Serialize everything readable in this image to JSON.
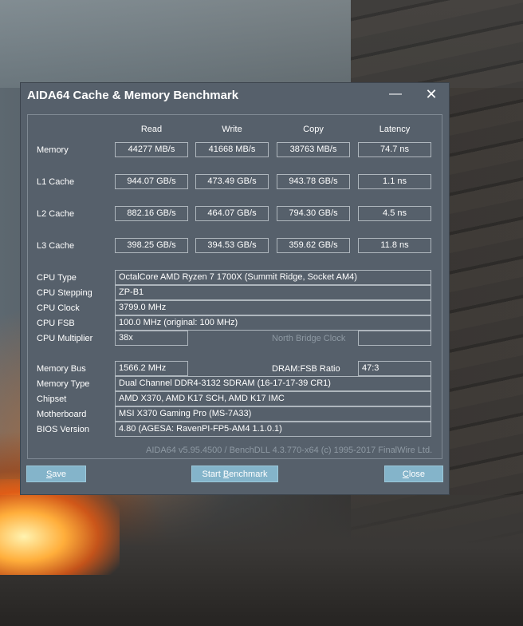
{
  "window": {
    "title": "AIDA64 Cache & Memory Benchmark",
    "minimize_glyph": "—",
    "close_glyph": "✕"
  },
  "headers": {
    "read": "Read",
    "write": "Write",
    "copy": "Copy",
    "latency": "Latency"
  },
  "rows": [
    {
      "label": "Memory",
      "read": "44277 MB/s",
      "write": "41668 MB/s",
      "copy": "38763 MB/s",
      "latency": "74.7 ns"
    },
    {
      "label": "L1 Cache",
      "read": "944.07 GB/s",
      "write": "473.49 GB/s",
      "copy": "943.78 GB/s",
      "latency": "1.1 ns"
    },
    {
      "label": "L2 Cache",
      "read": "882.16 GB/s",
      "write": "464.07 GB/s",
      "copy": "794.30 GB/s",
      "latency": "4.5 ns"
    },
    {
      "label": "L3 Cache",
      "read": "398.25 GB/s",
      "write": "394.53 GB/s",
      "copy": "359.62 GB/s",
      "latency": "11.8 ns"
    }
  ],
  "cpu": {
    "type_label": "CPU Type",
    "type": "OctalCore AMD Ryzen 7 1700X  (Summit Ridge, Socket AM4)",
    "stepping_label": "CPU Stepping",
    "stepping": "ZP-B1",
    "clock_label": "CPU Clock",
    "clock": "3799.0 MHz",
    "fsb_label": "CPU FSB",
    "fsb": "100.0 MHz  (original: 100 MHz)",
    "multiplier_label": "CPU Multiplier",
    "multiplier": "38x",
    "nb_clock_label": "North Bridge Clock",
    "nb_clock": ""
  },
  "memory": {
    "bus_label": "Memory Bus",
    "bus": "1566.2 MHz",
    "ratio_label": "DRAM:FSB Ratio",
    "ratio": "47:3",
    "type_label": "Memory Type",
    "type": "Dual Channel DDR4-3132 SDRAM  (16-17-17-39 CR1)",
    "chipset_label": "Chipset",
    "chipset": "AMD X370, AMD K17 SCH, AMD K17 IMC",
    "motherboard_label": "Motherboard",
    "motherboard": "MSI X370 Gaming Pro (MS-7A33)",
    "bios_label": "BIOS Version",
    "bios": "4.80  (AGESA: RavenPI-FP5-AM4 1.1.0.1)"
  },
  "footer": "AIDA64 v5.95.4500 / BenchDLL 4.3.770-x64  (c) 1995-2017 FinalWire Ltd.",
  "buttons": {
    "save": {
      "mnemonic": "S",
      "rest": "ave"
    },
    "start": {
      "pre": "Start ",
      "mnemonic": "B",
      "rest": "enchmark"
    },
    "close": {
      "mnemonic": "C",
      "rest": "lose"
    }
  },
  "colors": {
    "window_bg": "#56606b",
    "button_bg": "#84b4ca",
    "border": "#aeb6bd",
    "dim_text": "#8e99a3"
  }
}
